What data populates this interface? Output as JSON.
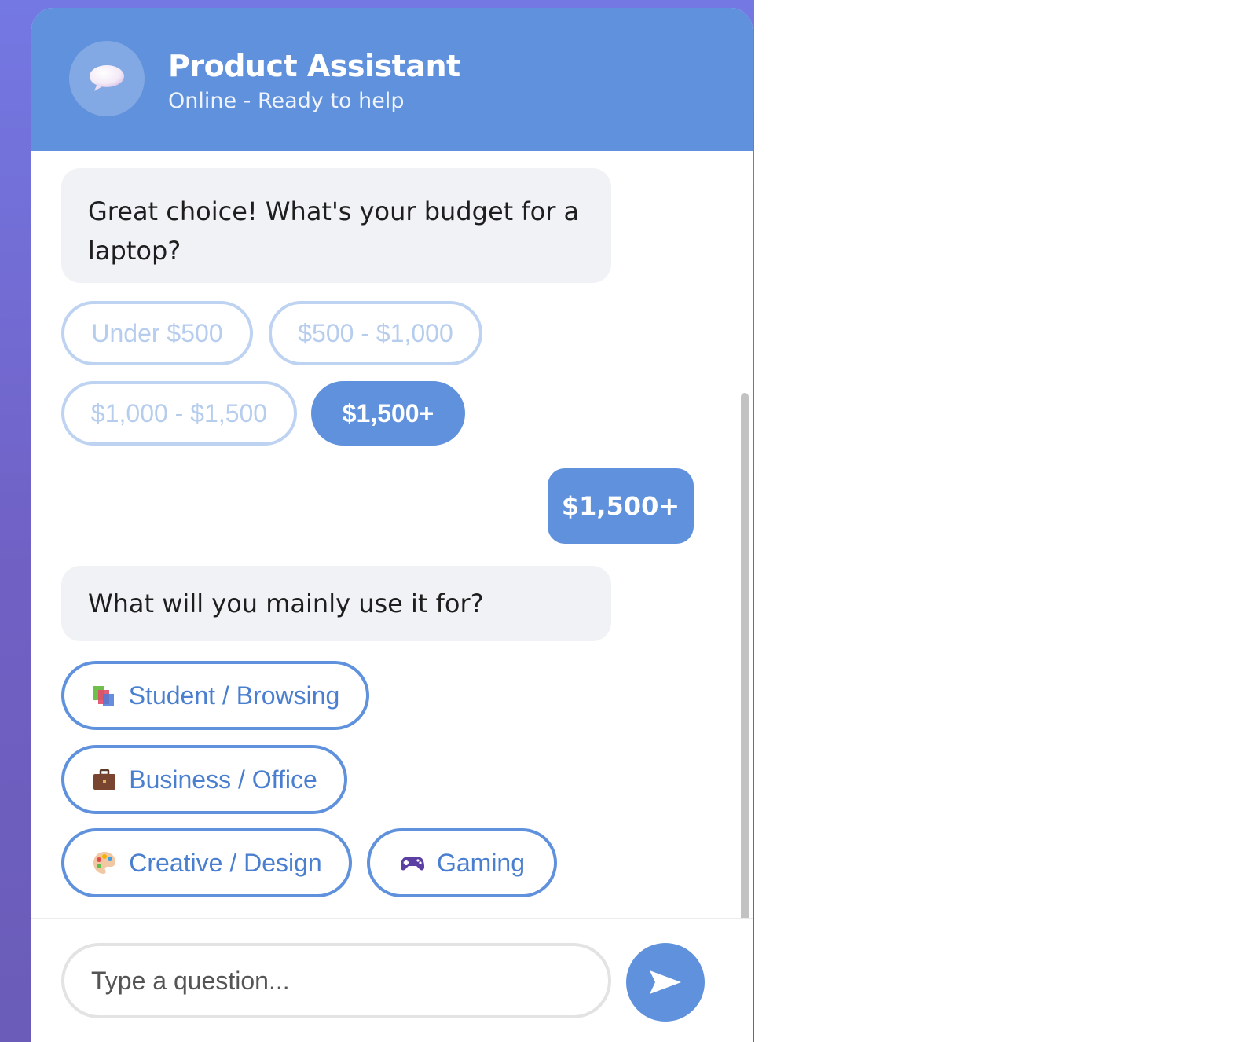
{
  "header": {
    "title": "Product Assistant",
    "status": "Online - Ready to help",
    "avatar_icon": "speech-bubble-icon"
  },
  "messages": {
    "bot_budget": "Great choice! What's your budget for a laptop?",
    "budget_options": [
      "Under $500",
      "$500 - $1,000",
      "$1,000 - $1,500",
      "$1,500+"
    ],
    "selected_budget": "$1,500+",
    "user_reply": "$1,500+",
    "bot_usage": "What will you mainly use it for?",
    "usage_options": [
      {
        "label": "Student / Browsing",
        "icon": "books-icon"
      },
      {
        "label": "Business / Office",
        "icon": "briefcase-icon"
      },
      {
        "label": "Creative / Design",
        "icon": "palette-icon"
      },
      {
        "label": "Gaming",
        "icon": "gamepad-icon"
      }
    ]
  },
  "input": {
    "placeholder": "Type a question...",
    "value": ""
  },
  "send": {
    "icon": "send-icon"
  },
  "colors": {
    "accent": "#5f91dc",
    "background_gradient_top": "#7478e3",
    "background_gradient_bottom": "#6a5cb8",
    "bot_bubble": "#f1f2f6"
  }
}
